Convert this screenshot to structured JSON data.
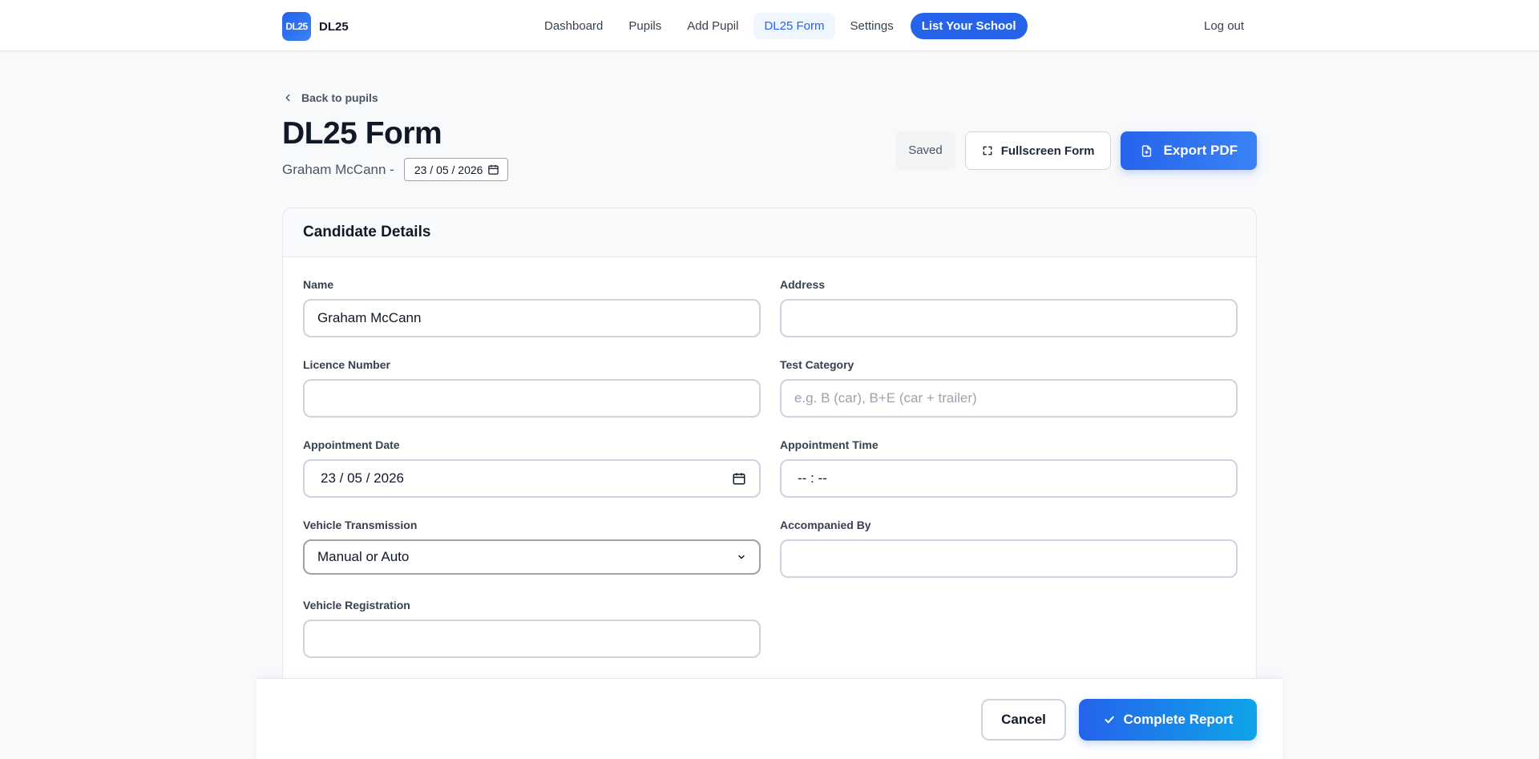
{
  "brand": {
    "logo_text": "DL25",
    "name": "DL25"
  },
  "nav": {
    "items": [
      {
        "label": "Dashboard"
      },
      {
        "label": "Pupils"
      },
      {
        "label": "Add Pupil"
      },
      {
        "label": "DL25 Form",
        "active": true
      },
      {
        "label": "Settings"
      }
    ],
    "cta": "List Your School",
    "logout": "Log out"
  },
  "header": {
    "back_label": "Back to pupils",
    "title": "DL25 Form",
    "pupil_name": "Graham McCann -",
    "date": "23 / 05 / 2026",
    "saved_label": "Saved",
    "fullscreen_label": "Fullscreen Form",
    "export_label": "Export PDF"
  },
  "card": {
    "title": "Candidate Details",
    "fields": {
      "name": {
        "label": "Name",
        "value": "Graham McCann"
      },
      "address": {
        "label": "Address",
        "value": ""
      },
      "licence": {
        "label": "Licence Number",
        "value": ""
      },
      "category": {
        "label": "Test Category",
        "placeholder": "e.g. B (car), B+E (car + trailer)"
      },
      "appt_date": {
        "label": "Appointment Date",
        "value": "23 / 05 / 2026"
      },
      "appt_time": {
        "label": "Appointment Time",
        "value": "-- : --"
      },
      "transmission": {
        "label": "Vehicle Transmission",
        "value": "Manual or Auto"
      },
      "accompanied": {
        "label": "Accompanied By",
        "value": ""
      },
      "registration": {
        "label": "Vehicle Registration",
        "value": ""
      }
    }
  },
  "footer": {
    "cancel_label": "Cancel",
    "complete_label": "Complete Report"
  },
  "colors": {
    "accent": "#2563eb",
    "gradient_end": "#0ea5e9",
    "background": "#f8f9fb"
  }
}
